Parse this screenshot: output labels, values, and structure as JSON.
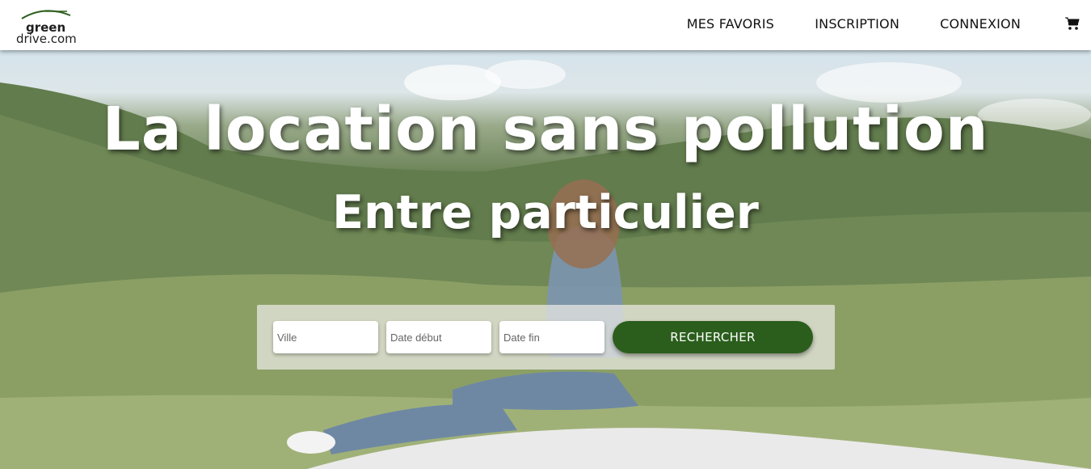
{
  "brand": {
    "logo_line1": "green",
    "logo_line2": "drive.com",
    "accent_color": "#2b5e1c"
  },
  "nav": {
    "items": [
      {
        "label": "MES FAVORIS"
      },
      {
        "label": "INSCRIPTION"
      },
      {
        "label": "CONNEXION"
      }
    ],
    "cart_icon": "shopping-cart-icon"
  },
  "hero": {
    "title": "La location sans pollution",
    "subtitle": "Entre particulier"
  },
  "search": {
    "city_placeholder": "Ville",
    "start_placeholder": "Date début",
    "end_placeholder": "Date fin",
    "submit_label": "RECHERCHER"
  }
}
